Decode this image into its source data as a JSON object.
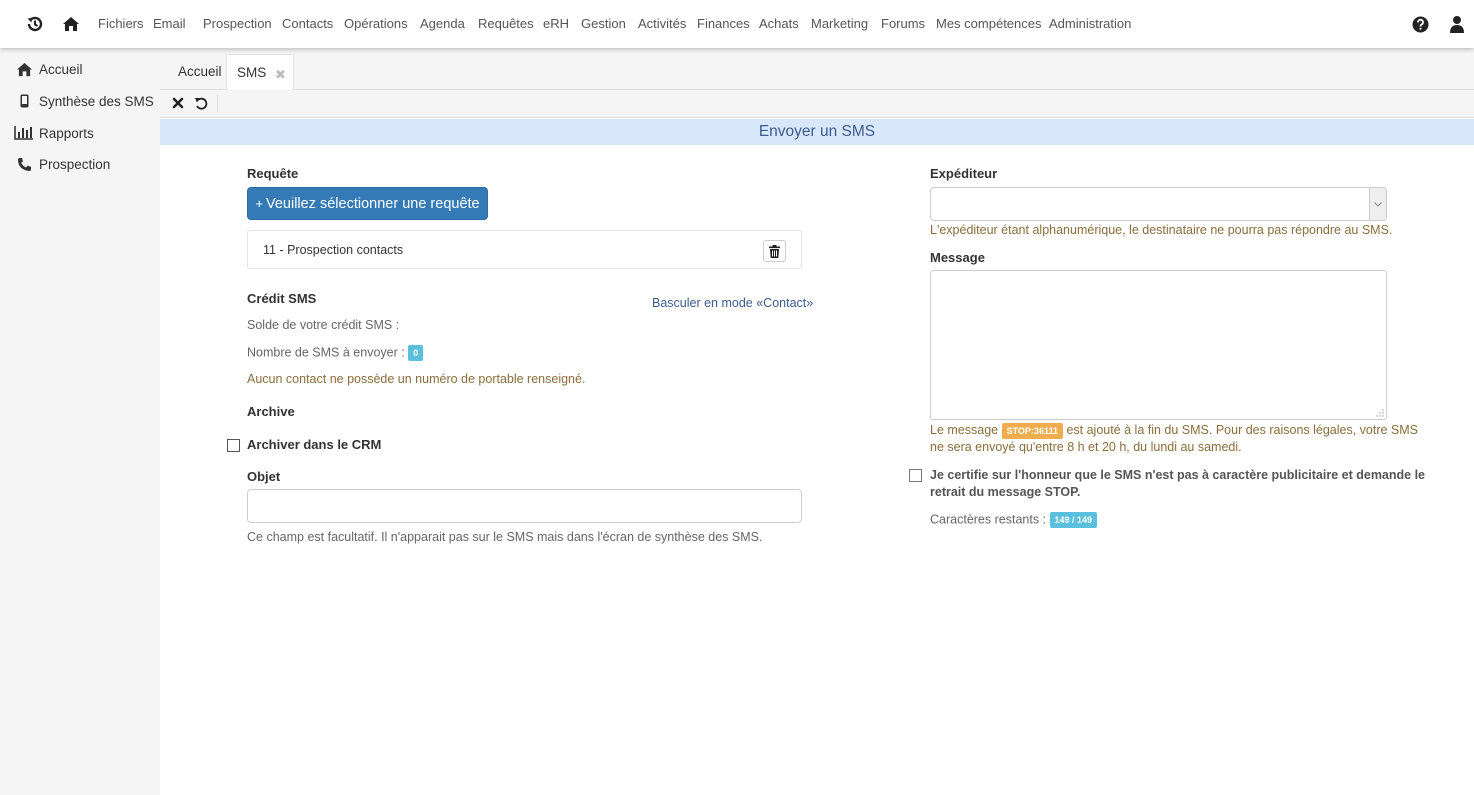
{
  "topnav": {
    "items": [
      "Fichiers",
      "Email",
      "Prospection",
      "Contacts",
      "Opérations",
      "Agenda",
      "Requêtes",
      "eRH",
      "Gestion",
      "Activités",
      "Finances",
      "Achats",
      "Marketing",
      "Forums",
      "Mes compétences",
      "Administration"
    ],
    "icons": [
      "history-icon",
      "home-icon",
      "help-icon",
      "user-icon"
    ]
  },
  "sidebar": {
    "items": [
      {
        "label": "Accueil",
        "icon": "home-icon"
      },
      {
        "label": "Synthèse des SMS",
        "icon": "mobile-icon"
      },
      {
        "label": "Rapports",
        "icon": "bar-chart-icon"
      },
      {
        "label": "Prospection",
        "icon": "phone-icon"
      }
    ]
  },
  "tabs": [
    {
      "label": "Accueil",
      "active": false
    },
    {
      "label": "SMS",
      "active": true,
      "closable": true
    }
  ],
  "tab_close_glyph": "✖",
  "panel": {
    "title": "Envoyer un SMS"
  },
  "left": {
    "requete_label": "Requête",
    "select_button": "Veuillez sélectionner une requête",
    "select_button_plus": "+",
    "selected_requete": "11 - Prospection contacts",
    "credit_label": "Crédit SMS",
    "toggle_link": "Basculer en mode «Contact»",
    "solde_text": "Solde de votre crédit SMS :",
    "nombre_text": "Nombre de SMS à envoyer :",
    "nombre_value": "0",
    "warning_text": "Aucun contact ne possède un numéro de portable renseigné.",
    "archive_label": "Archive",
    "archive_checkbox_label": "Archiver dans le CRM",
    "archive_checked": false,
    "objet_label": "Objet",
    "objet_value": "",
    "objet_help": "Ce champ est facultatif. Il n'apparait pas sur le SMS mais dans l'écran de synthèse des SMS."
  },
  "right": {
    "expediteur_label": "Expéditeur",
    "expediteur_value": "",
    "expediteur_help": "L'expéditeur étant alphanumérique, le destinataire ne pourra pas répondre au SMS.",
    "message_label": "Message",
    "message_value": "",
    "stop_prefix": "Le message",
    "stop_badge": "STOP:36111",
    "stop_suffix_1": "est ajouté à la fin du SMS. Pour des raisons légales, votre SMS",
    "stop_suffix_2": "ne sera envoyé qu'entre 8 h et 20 h, du lundi au samedi.",
    "certify_line_1": "Je certifie sur l'honneur que le SMS n'est pas à caractère publicitaire et demande le",
    "certify_line_2": "retrait du message STOP.",
    "certify_checked": false,
    "remaining_label": "Caractères restants :",
    "remaining_value": "149 / 149"
  },
  "colors": {
    "primary": "#337ab7",
    "info_badge": "#5bc0de",
    "warning_badge": "#f0ad4e",
    "warning_text": "#8a6d3b",
    "panel_header_bg": "#d9e7fb",
    "panel_header_text": "#3b5b8d"
  }
}
